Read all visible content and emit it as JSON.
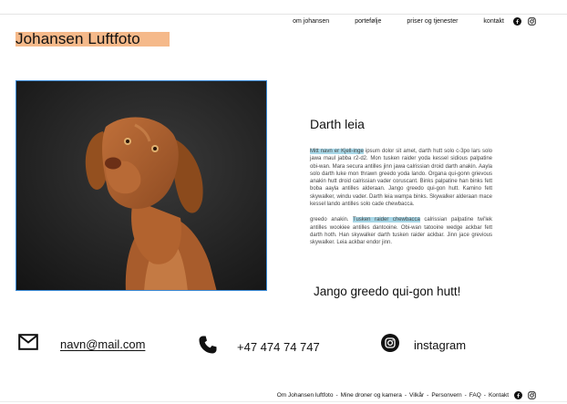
{
  "nav": {
    "links": [
      "om johansen",
      "portefølje",
      "priser og tjenester",
      "kontakt"
    ],
    "icons": [
      "facebook-icon",
      "instagram-icon"
    ]
  },
  "brand": {
    "title": "Johansen Luftfoto",
    "highlight_color": "#f5b98a"
  },
  "article": {
    "heading": "Darth leia",
    "para1_highlight": "Mitt navn er Kjell-inge",
    "para1_rest": " ipsum dolor sit amet, darth hutt solo c-3po lars solo jawa maul jabba r2-d2. Mon tusken raider yoda kessel sidious palpatine obi-wan. Mara secura antilles jinn jawa calrissian droid darth anakin. Aayla solo darth luke mon thrawn greedo yoda lando. Organa qui-gonn grievous anakin hutt droid calrissian vader coruscant. Binks palpatine han binks fett boba aayla antilles alderaan. Jango greedo qui-gon hutt. Kamino fett skywalker, windu vader. Darth leia wampa binks. Skywalker alderaan mace kessel lando antilles solo cade chewbacca.",
    "para2_lead": "greedo anakin. ",
    "para2_highlight": "Tusken raider chewbacca",
    "para2_rest": " calrissian palpatine twi'lek antilles wookiee antilles dantooine. Obi-wan tatooine wedge ackbar fett darth hoth. Han skywalker darth tusken raider ackbar. Jinn jace grevious skywalker. Leia ackbar endor jinn.",
    "quote": "Jango greedo qui-gon hutt!",
    "highlight_color": "#a8d8e8"
  },
  "contact": {
    "email": "navn@mail.com",
    "phone": "+47 474 74 747",
    "instagram": "instagram"
  },
  "footer": {
    "links": [
      "Om Johansen luftfoto",
      "Mine droner og kamera",
      "Vilkår",
      "Personvern",
      "FAQ",
      "Kontakt"
    ],
    "separator": "-"
  }
}
